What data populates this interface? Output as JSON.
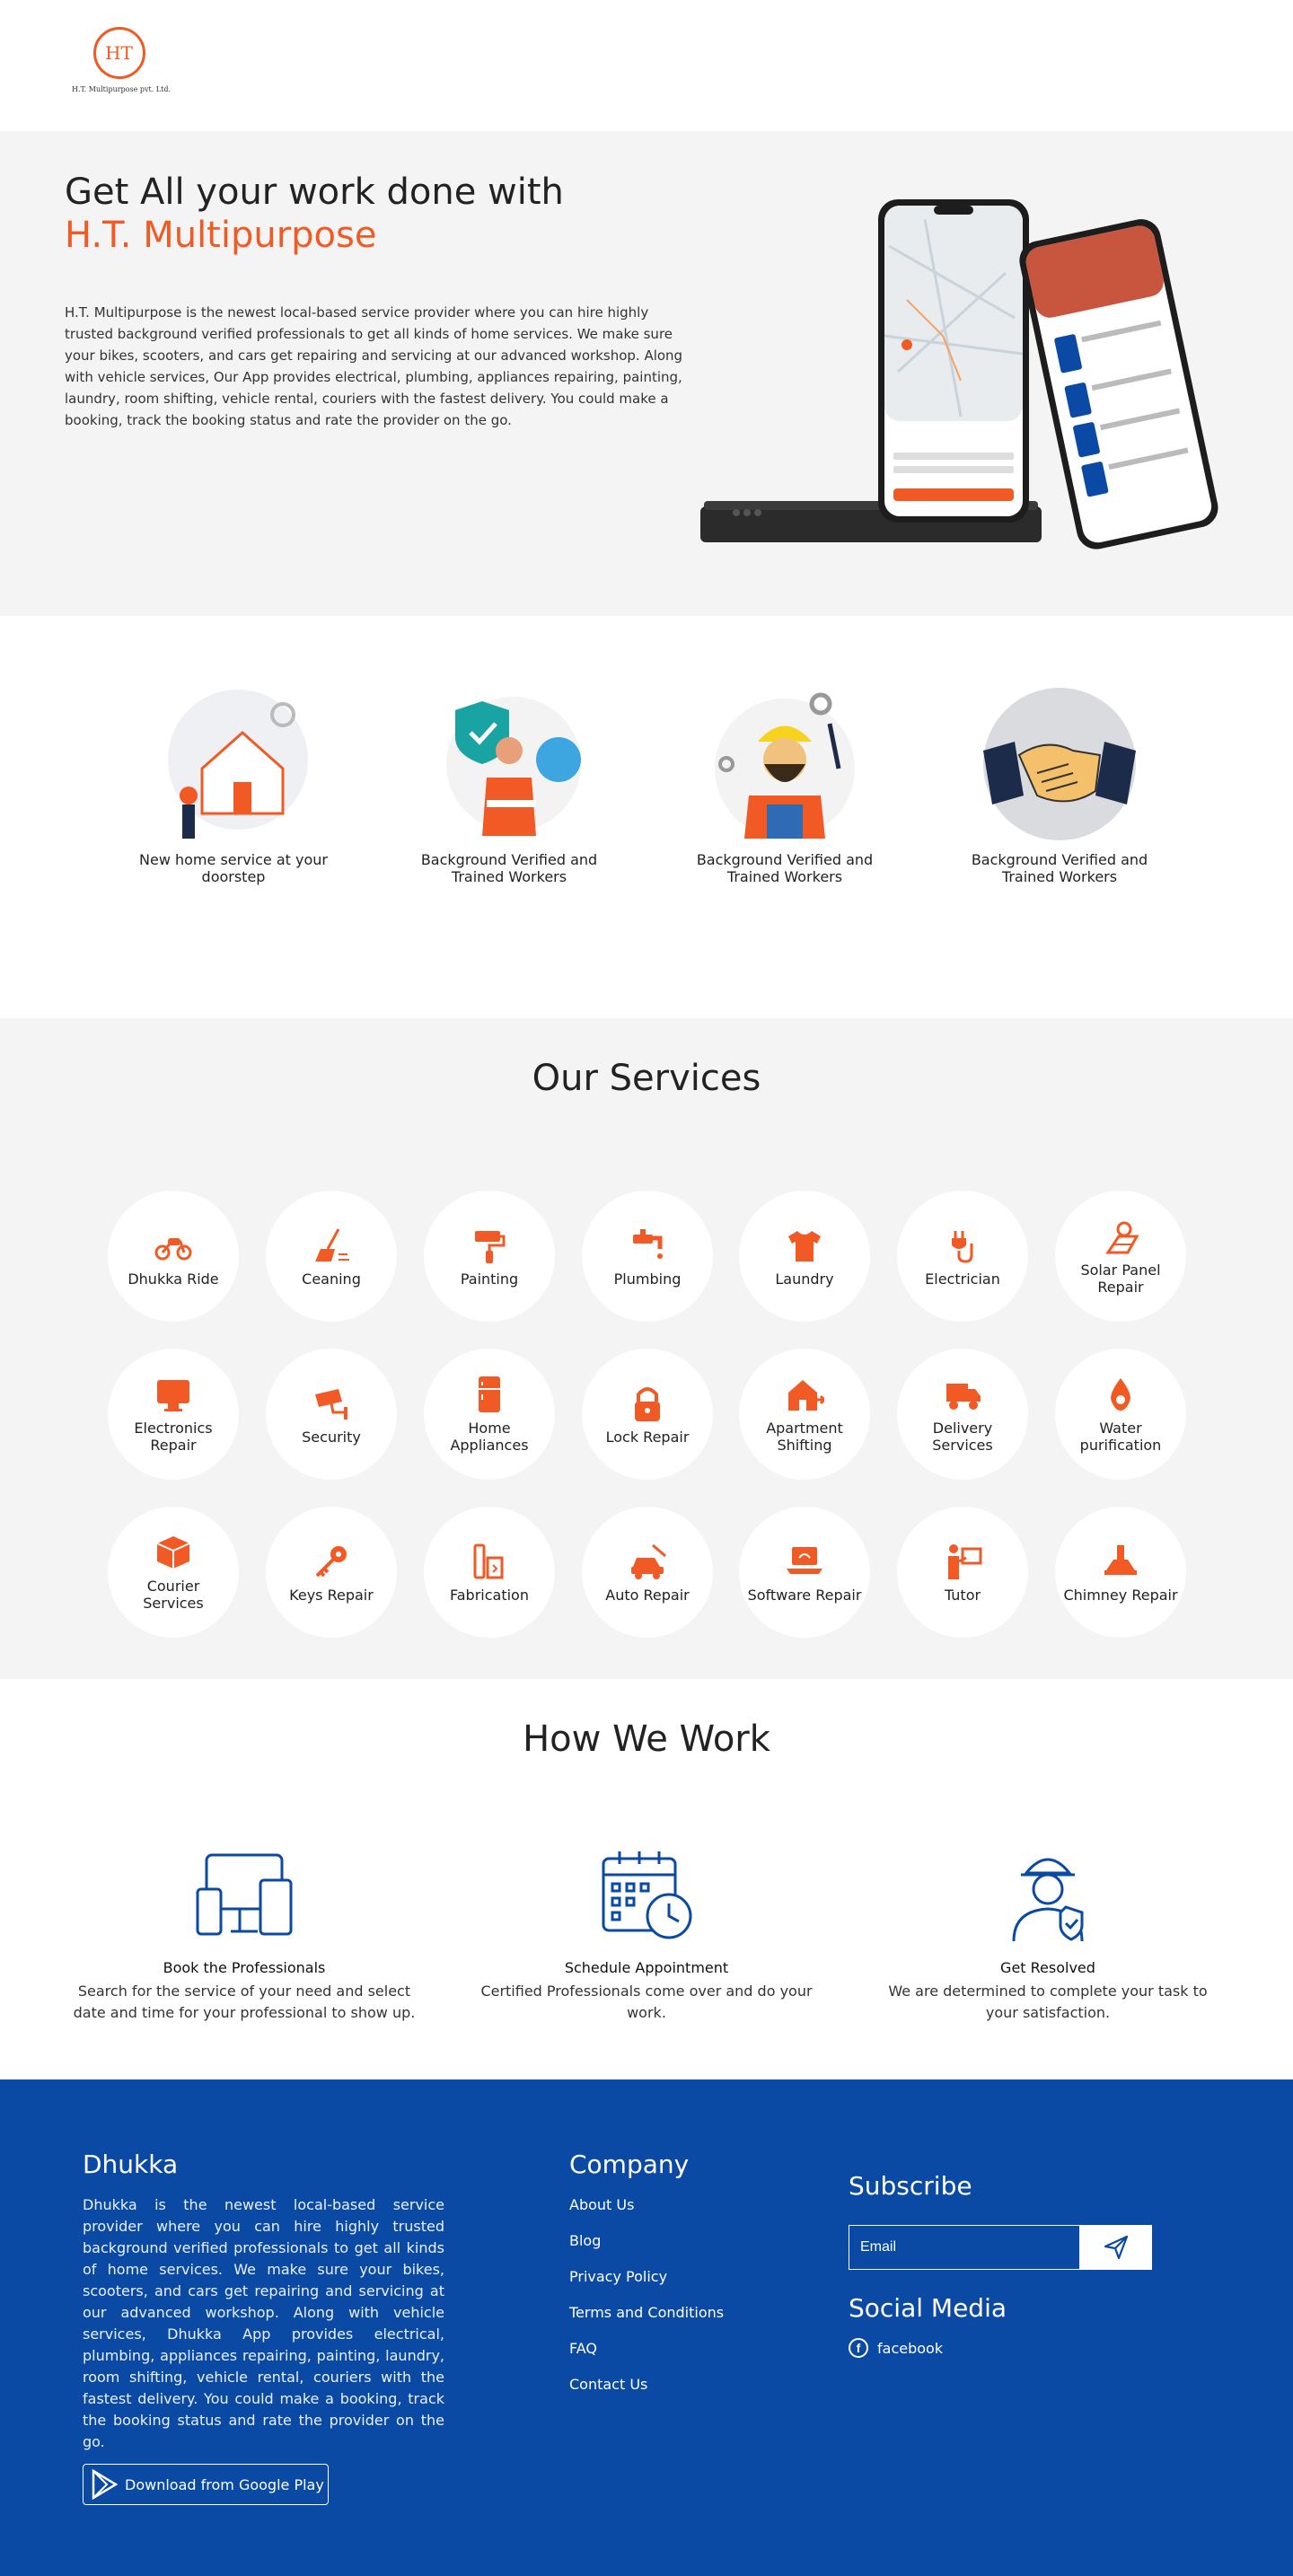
{
  "header": {
    "logo_initials": "HT",
    "logo_text": "H.T. Multipurpose pvt. Ltd."
  },
  "hero": {
    "title": "Get All your work done with",
    "brand": "H.T. Multipurpose",
    "description": "H.T. Multipurpose is the newest local-based service provider where you can hire highly trusted background verified professionals to get all kinds of home services. We make sure your bikes, scooters, and cars get repairing and servicing at our advanced workshop. Along with vehicle services, Our App provides electrical, plumbing, appliances repairing, painting, laundry, room shifting, vehicle rental, couriers with the fastest delivery. You could make a booking, track the booking status and rate the provider on the go."
  },
  "features": [
    {
      "label": "New home service at your doorstep",
      "icon": "house-worker-illustration"
    },
    {
      "label": "Background Verified and Trained Workers",
      "icon": "verified-worker-illustration"
    },
    {
      "label": "Background Verified and Trained Workers",
      "icon": "construction-worker-illustration"
    },
    {
      "label": "Background Verified and Trained Workers",
      "icon": "handshake-illustration"
    }
  ],
  "services": {
    "title": "Our Services",
    "items": [
      {
        "label": "Dhukka Ride",
        "icon": "motorbike-icon"
      },
      {
        "label": "Ceaning",
        "icon": "broom-icon"
      },
      {
        "label": "Painting",
        "icon": "paint-roller-icon"
      },
      {
        "label": "Plumbing",
        "icon": "faucet-icon"
      },
      {
        "label": "Laundry",
        "icon": "tshirt-icon"
      },
      {
        "label": "Electrician",
        "icon": "plug-icon"
      },
      {
        "label": "Solar Panel Repair",
        "icon": "solar-icon"
      },
      {
        "label": "Electronics Repair",
        "icon": "monitor-icon"
      },
      {
        "label": "Security",
        "icon": "cctv-icon"
      },
      {
        "label": "Home Appliances",
        "icon": "fridge-icon"
      },
      {
        "label": "Lock Repair",
        "icon": "padlock-icon"
      },
      {
        "label": "Apartment Shifting",
        "icon": "moving-icon"
      },
      {
        "label": "Delivery Services",
        "icon": "truck-icon"
      },
      {
        "label": "Water purification",
        "icon": "water-drop-icon"
      },
      {
        "label": "Courier Services",
        "icon": "box-icon"
      },
      {
        "label": "Keys Repair",
        "icon": "key-icon"
      },
      {
        "label": "Fabrication",
        "icon": "welding-icon"
      },
      {
        "label": "Auto Repair",
        "icon": "car-repair-icon"
      },
      {
        "label": "Software Repair",
        "icon": "laptop-icon"
      },
      {
        "label": "Tutor",
        "icon": "teacher-icon"
      },
      {
        "label": "Chimney Repair",
        "icon": "chimney-icon"
      }
    ]
  },
  "how": {
    "title": "How We Work",
    "steps": [
      {
        "title": "Book the Professionals",
        "desc": "Search for the service of your need and select date and time for your professional to show up.",
        "icon": "devices-icon"
      },
      {
        "title": "Schedule Appointment",
        "desc": "Certified Professionals come over and do your work.",
        "icon": "calendar-clock-icon"
      },
      {
        "title": "Get Resolved",
        "desc": "We are determined to complete your task to your satisfaction.",
        "icon": "worker-shield-icon"
      }
    ]
  },
  "footer": {
    "brand": "Dhukka",
    "about": "Dhukka is the newest local-based service provider where you can hire highly trusted background verified professionals to get all kinds of home services. We make sure your bikes, scooters, and cars get repairing and servicing at our advanced workshop. Along with vehicle services, Dhukka App provides electrical, plumbing, appliances repairing, painting, laundry, room shifting, vehicle rental, couriers with the fastest delivery. You could make a booking, track the booking status and rate the provider on the go.",
    "google_play": "Download from Google Play",
    "company_title": "Company",
    "links": [
      "About Us",
      "Blog",
      "Privacy Policy",
      "Terms and Conditions",
      "FAQ",
      "Contact Us"
    ],
    "subscribe_title": "Subscribe",
    "email_placeholder": "Email",
    "social_title": "Social Media",
    "facebook": "facebook"
  },
  "colors": {
    "accent": "#f15a24",
    "footer_bg": "#0a4aa5",
    "section_bg": "#f4f4f4",
    "icon_blue": "#0a4aa5"
  }
}
